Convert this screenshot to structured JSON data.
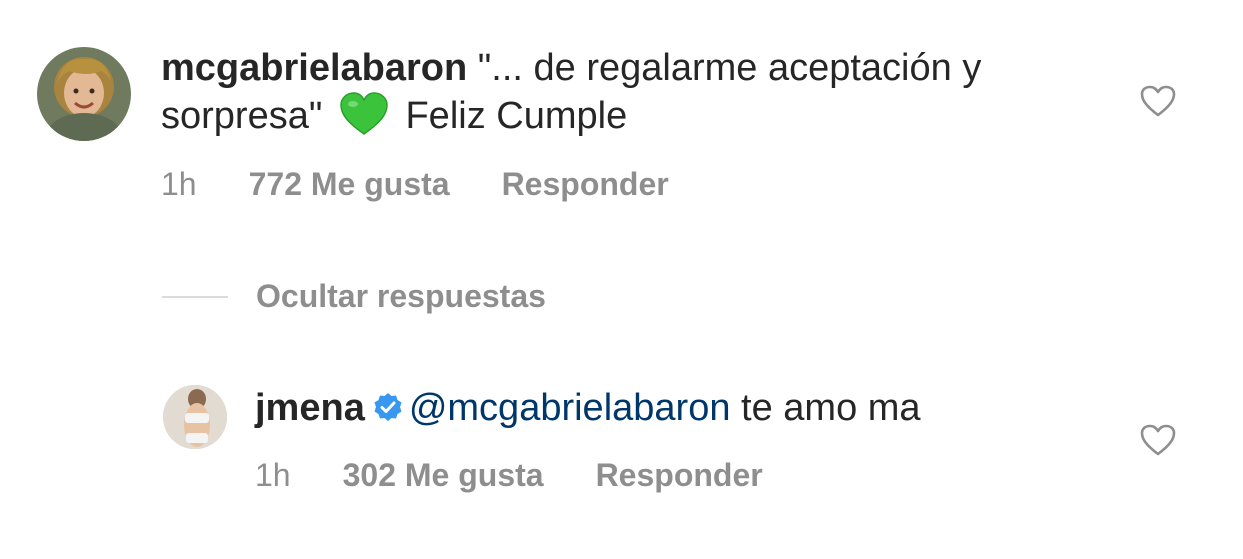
{
  "comments": [
    {
      "username": "mcgabrielabaron",
      "text_part1": "\"... de regalarme aceptación y sorpresa\"",
      "emoji": "green-heart-emoji",
      "text_part2": "Feliz Cumple",
      "time": "1h",
      "likes": "772 Me gusta",
      "reply": "Responder",
      "like_icon": "heart-outline-icon"
    }
  ],
  "replies_toggle": {
    "label": "Ocultar respuestas"
  },
  "replies": [
    {
      "username": "jmena",
      "verified": true,
      "mention": "@mcgabrielabaron",
      "text": "te amo ma",
      "time": "1h",
      "likes": "302 Me gusta",
      "reply": "Responder",
      "like_icon": "heart-outline-icon"
    }
  ],
  "colors": {
    "primary_text": "#262626",
    "secondary_text": "#8e8e8e",
    "mention": "#00376b",
    "verified_badge": "#3897f0",
    "emoji_heart": "#3cc33c"
  }
}
